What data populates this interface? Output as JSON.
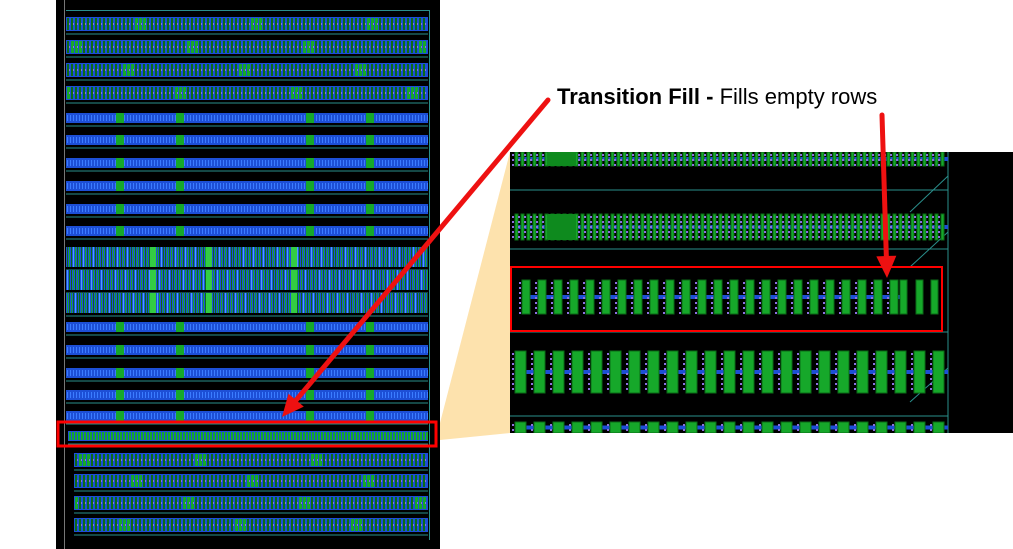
{
  "annotation": {
    "title": "Transition Fill -",
    "description": "Fills empty rows"
  },
  "colors": {
    "cell_green": "#16a82a",
    "cell_dark_green": "#0b6b17",
    "metal_blue": "#1d4fd6",
    "via_purple": "#8d6fe0",
    "row_teal": "#2a8f8c",
    "highlight_red": "#ff0000",
    "arrow_red": "#ee1111",
    "zoom_wedge": "#fde2ad",
    "background": "#000000"
  },
  "icons": {
    "arrow_to_overview": "arrow-icon",
    "arrow_to_zoom": "arrow-icon"
  }
}
